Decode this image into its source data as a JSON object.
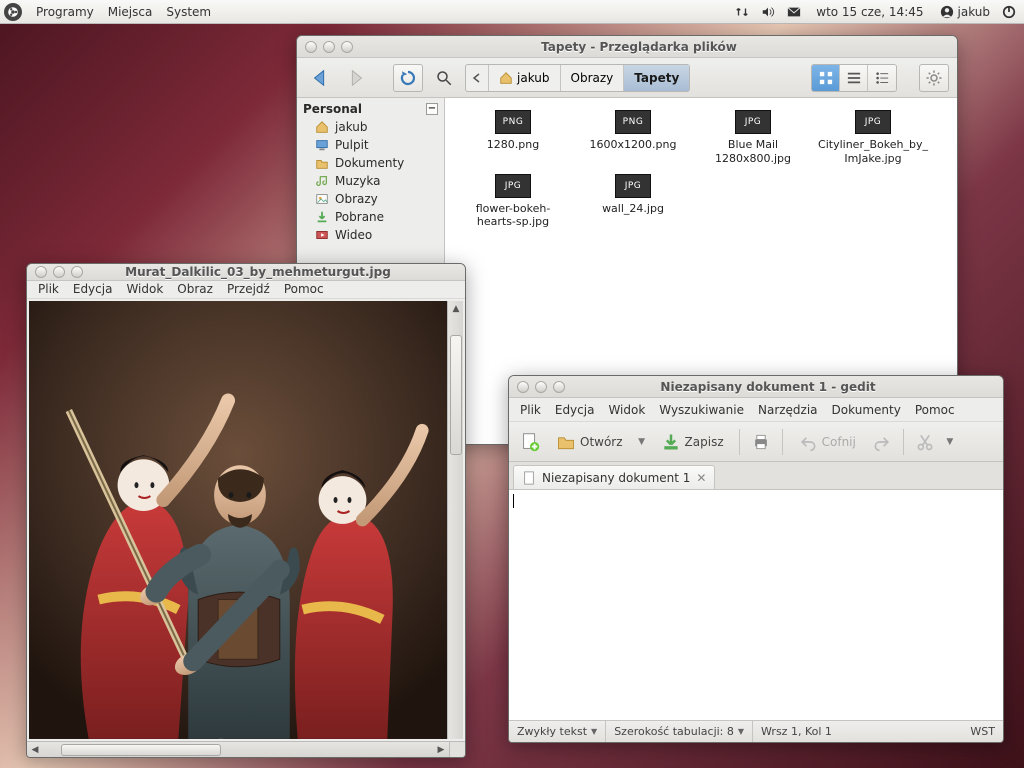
{
  "panel": {
    "menus": [
      "Programy",
      "Miejsca",
      "System"
    ],
    "clock": "wto 15 cze, 14:45",
    "user": "jakub"
  },
  "file_manager": {
    "title": "Tapety - Przeglądarka plików",
    "sidebar": {
      "section": "Personal",
      "items": [
        {
          "icon": "home",
          "label": "jakub"
        },
        {
          "icon": "desktop",
          "label": "Pulpit"
        },
        {
          "icon": "folder",
          "label": "Dokumenty"
        },
        {
          "icon": "music",
          "label": "Muzyka"
        },
        {
          "icon": "pictures",
          "label": "Obrazy"
        },
        {
          "icon": "download",
          "label": "Pobrane"
        },
        {
          "icon": "video",
          "label": "Wideo"
        }
      ]
    },
    "path": [
      {
        "label": "jakub",
        "icon": "home"
      },
      {
        "label": "Obrazy"
      },
      {
        "label": "Tapety",
        "active": true
      }
    ],
    "files": [
      {
        "ext": "PNG",
        "name": "1280.png"
      },
      {
        "ext": "PNG",
        "name": "1600x1200.png"
      },
      {
        "ext": "JPG",
        "name": "Blue Mail 1280x800.jpg"
      },
      {
        "ext": "JPG",
        "name": "Cityliner_Bokeh_by_ImJake.jpg"
      },
      {
        "ext": "JPG",
        "name": "flower-bokeh-hearts-sp.jpg"
      },
      {
        "ext": "JPG",
        "name": "wall_24.jpg"
      }
    ]
  },
  "image_viewer": {
    "title": "Murat_Dalkilic_03_by_mehmeturgut.jpg",
    "menus": [
      "Plik",
      "Edycja",
      "Widok",
      "Obraz",
      "Przejdź",
      "Pomoc"
    ]
  },
  "gedit": {
    "title": "Niezapisany dokument 1 - gedit",
    "menus": [
      "Plik",
      "Edycja",
      "Widok",
      "Wyszukiwanie",
      "Narzędzia",
      "Dokumenty",
      "Pomoc"
    ],
    "toolbar": {
      "open": "Otwórz",
      "save": "Zapisz",
      "undo": "Cofnij"
    },
    "tab": "Niezapisany dokument 1",
    "status": {
      "syntax": "Zwykły tekst",
      "tabwidth": "Szerokość tabulacji:  8",
      "pos": "Wrsz 1, Kol 1",
      "ins": "WST"
    }
  }
}
